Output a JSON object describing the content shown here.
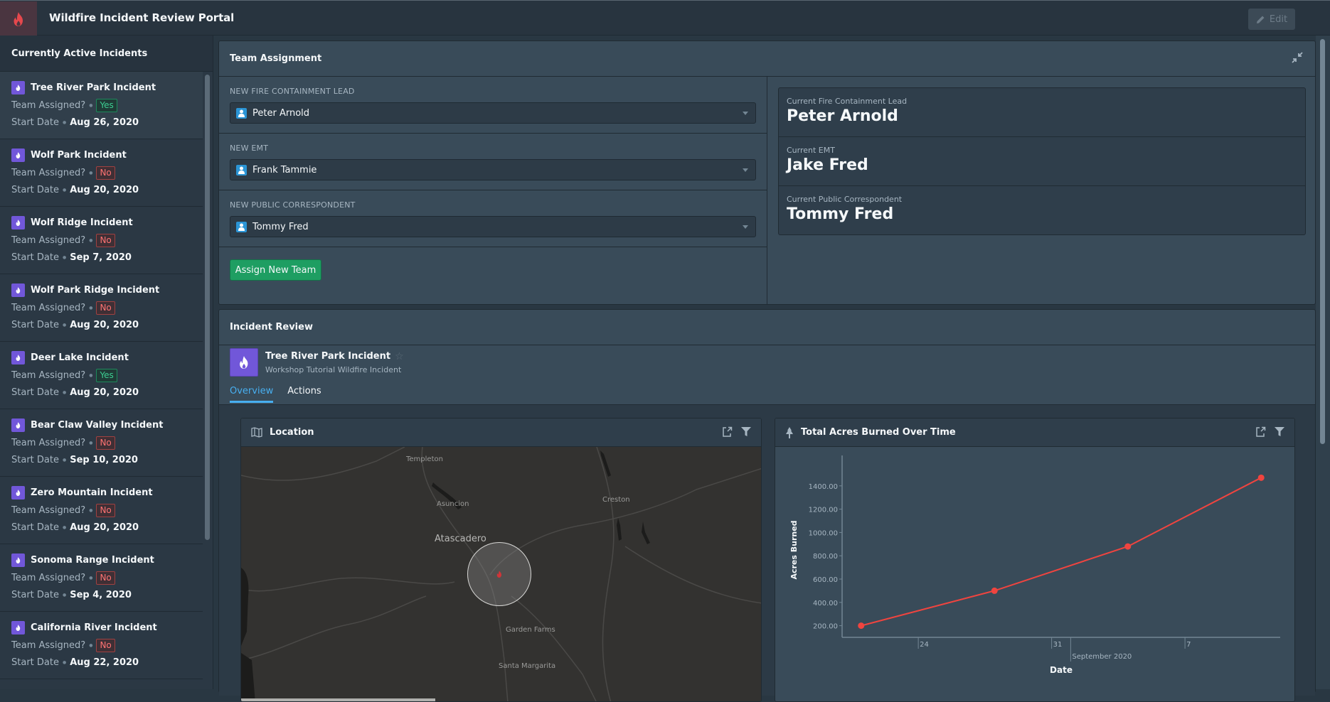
{
  "app": {
    "title": "Wildfire Incident Review Portal",
    "logo_icon": "fire-icon",
    "edit_label": "Edit",
    "brand_color": "#e5484d"
  },
  "sidebar": {
    "title": "Currently Active Incidents",
    "assigned_label": "Team Assigned?",
    "start_label": "Start Date",
    "incidents": [
      {
        "name": "Tree River Park Incident",
        "assigned": "Yes",
        "start_date": "Aug 26, 2020",
        "selected": true
      },
      {
        "name": "Wolf Park Incident",
        "assigned": "No",
        "start_date": "Aug 20, 2020"
      },
      {
        "name": "Wolf Ridge Incident",
        "assigned": "No",
        "start_date": "Sep 7, 2020"
      },
      {
        "name": "Wolf Park Ridge Incident",
        "assigned": "No",
        "start_date": "Aug 20, 2020"
      },
      {
        "name": "Deer Lake Incident",
        "assigned": "Yes",
        "start_date": "Aug 20, 2020"
      },
      {
        "name": "Bear Claw Valley Incident",
        "assigned": "No",
        "start_date": "Sep 10, 2020"
      },
      {
        "name": "Zero Mountain Incident",
        "assigned": "No",
        "start_date": "Aug 20, 2020"
      },
      {
        "name": "Sonoma Range Incident",
        "assigned": "No",
        "start_date": "Sep 4, 2020"
      },
      {
        "name": "California River Incident",
        "assigned": "No",
        "start_date": "Aug 22, 2020"
      }
    ]
  },
  "team_assignment": {
    "title": "Team Assignment",
    "fields": [
      {
        "label": "New Fire Containment Lead",
        "value": "Peter Arnold"
      },
      {
        "label": "New EMT",
        "value": "Frank Tammie"
      },
      {
        "label": "New Public Correspondent",
        "value": "Tommy Fred"
      }
    ],
    "assign_button": "Assign New Team",
    "current": [
      {
        "label": "Current Fire Containment Lead",
        "value": "Peter Arnold"
      },
      {
        "label": "Current EMT",
        "value": "Jake Fred"
      },
      {
        "label": "Current Public Correspondent",
        "value": "Tommy Fred"
      }
    ]
  },
  "incident_review": {
    "title": "Incident Review",
    "incident_name": "Tree River Park Incident",
    "incident_type": "Workshop Tutorial Wildfire Incident",
    "tabs": [
      "Overview",
      "Actions"
    ],
    "active_tab": "Overview",
    "location_card": {
      "title": "Location",
      "places": [
        "Templeton",
        "Asuncion",
        "Atascadero",
        "Creston",
        "Garden Farms",
        "Santa Margarita"
      ]
    },
    "chart_card": {
      "title": "Total Acres Burned Over Time"
    }
  },
  "chart_data": {
    "type": "line",
    "title": "Total Acres Burned Over Time",
    "xlabel": "Date",
    "ylabel": "Acres Burned",
    "x": [
      "2020-08-21",
      "2020-08-28",
      "2020-09-04",
      "2020-09-11"
    ],
    "series": [
      {
        "name": "Acres Burned",
        "values": [
          200,
          500,
          880,
          1470
        ],
        "color": "#f0443f"
      }
    ],
    "y_ticks": [
      "200.00",
      "400.00",
      "600.00",
      "800.00",
      "1000.00",
      "1200.00",
      "1400.00"
    ],
    "x_ticks": [
      "24",
      "31",
      "September 2020",
      "7"
    ],
    "ylim": [
      100,
      1600
    ],
    "xlim": [
      "2020-08-20",
      "2020-09-12"
    ],
    "grid": false
  }
}
